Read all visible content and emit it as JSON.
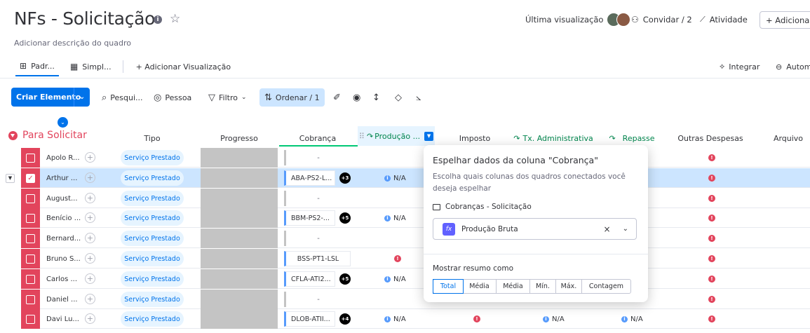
{
  "header": {
    "title": "NFs - Solicitação",
    "description": "Adicionar descrição do quadro",
    "last_view_label": "Última visualização",
    "invite_label": "Convidar / 2",
    "activity_label": "Atividade",
    "add_label": "+ Adicionar a"
  },
  "tabs": {
    "items": [
      {
        "label": "Padr..."
      },
      {
        "label": "Simpl..."
      }
    ],
    "add_view_label": "+ Adicionar Visualização",
    "integrate_label": "Integrar",
    "automate_label": "Autom"
  },
  "toolbar": {
    "create_label": "Criar Elemento",
    "search_label": "Pesqui...",
    "person_label": "Pessoa",
    "filter_label": "Filtro",
    "sort_label": "Ordenar / 1"
  },
  "group": {
    "title": "Para Solicitar"
  },
  "columns": {
    "tipo": "Tipo",
    "progresso": "Progresso",
    "cobranca": "Cobrança",
    "producao": "Produção ...",
    "imposto": "Imposto",
    "taxa": "Tx. Administrativa",
    "repasse": "Repasse",
    "outras": "Outras Despesas",
    "arquivo": "Arquivo"
  },
  "rows": [
    {
      "name": "Apolo R...",
      "tipo": "Serviço Prestado",
      "cobranca": "-",
      "producao": ""
    },
    {
      "name": "Arthur ...",
      "tipo": "Serviço Prestado",
      "cobranca": "ABA-PS2-L...",
      "cobranca_count": "+3",
      "producao": "N/A"
    },
    {
      "name": "August...",
      "tipo": "Serviço Prestado",
      "cobranca": "-",
      "producao": ""
    },
    {
      "name": "Benício ...",
      "tipo": "Serviço Prestado",
      "cobranca": "BBM-PS2-...",
      "cobranca_count": "+5",
      "producao": "N/A"
    },
    {
      "name": "Bernard...",
      "tipo": "Serviço Prestado",
      "cobranca": "-",
      "producao": ""
    },
    {
      "name": "Bruno S...",
      "tipo": "Serviço Prestado",
      "cobranca": "BSS-PT1-LSL",
      "producao": "!"
    },
    {
      "name": "Carlos ...",
      "tipo": "Serviço Prestado",
      "cobranca": "CFLA-ATI2...",
      "cobranca_count": "+5",
      "producao": "N/A"
    },
    {
      "name": "Daniel ...",
      "tipo": "Serviço Prestado",
      "cobranca": "-",
      "producao": ""
    },
    {
      "name": "Davi Lu...",
      "tipo": "Serviço Prestado",
      "cobranca": "DLOB-ATII...",
      "cobranca_count": "+4",
      "producao": "N/A"
    }
  ],
  "last_row": {
    "taxa": "N/A",
    "repasse": "N/A"
  },
  "popover": {
    "title": "Espelhar dados da coluna \"Cobrança\"",
    "subtitle": "Escolha quais colunas dos quadros conectados você deseja espelhar",
    "board_name": "Cobranças - Solicitação",
    "selected_column": "Produção Bruta",
    "resume_label": "Mostrar resumo como",
    "options": [
      "Total",
      "Média",
      "Média",
      "Mín.",
      "Máx.",
      "Contagem"
    ],
    "selected_option": "Total"
  },
  "colors": {
    "accent": "#0073ea",
    "group": "#e2445c",
    "green": "#00c875"
  }
}
